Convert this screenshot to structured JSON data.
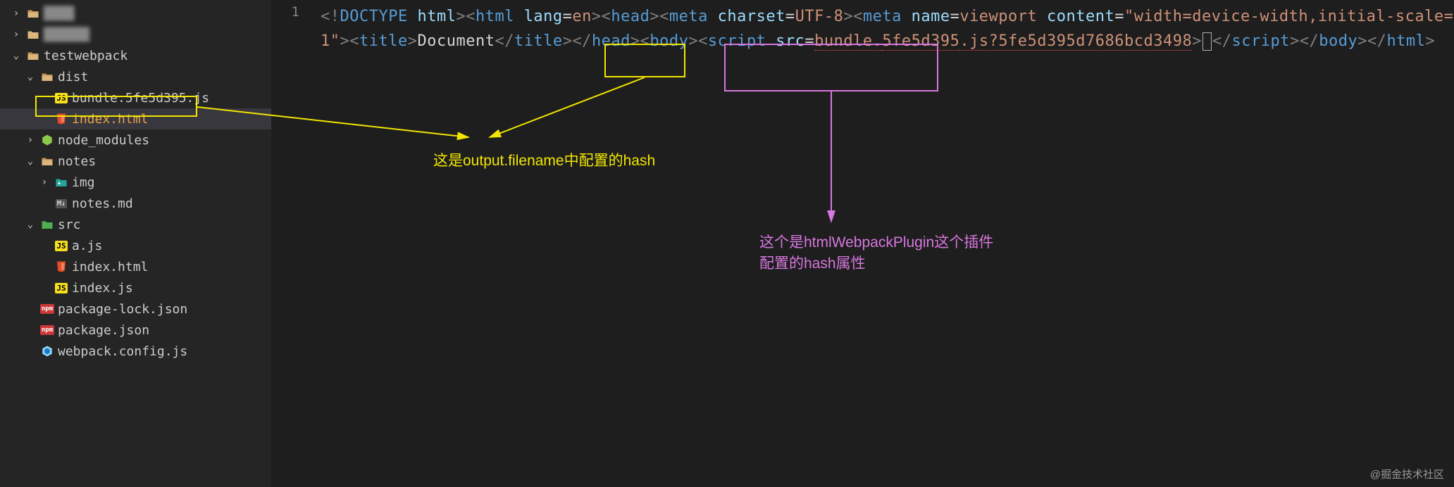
{
  "sidebar": {
    "items": [
      {
        "label": "████",
        "icon": "folder-open",
        "chevron": ">",
        "depth": 0,
        "blur": true
      },
      {
        "label": "██████",
        "icon": "folder",
        "chevron": ">",
        "depth": 0,
        "blur": true
      },
      {
        "label": "testwebpack",
        "icon": "folder-open",
        "chevron": "∨",
        "depth": 0
      },
      {
        "label": "dist",
        "icon": "folder-open",
        "chevron": "∨",
        "depth": 1
      },
      {
        "label": "bundle.5fe5d395.js",
        "icon": "js",
        "chevron": "",
        "depth": 2,
        "box": "yellow"
      },
      {
        "label": "index.html",
        "icon": "html",
        "chevron": "",
        "depth": 2,
        "selected": true
      },
      {
        "label": "node_modules",
        "icon": "node",
        "chevron": ">",
        "depth": 1
      },
      {
        "label": "notes",
        "icon": "folder-open",
        "chevron": "∨",
        "depth": 1
      },
      {
        "label": "img",
        "icon": "img-folder",
        "chevron": ">",
        "depth": 2
      },
      {
        "label": "notes.md",
        "icon": "md",
        "chevron": "",
        "depth": 2
      },
      {
        "label": "src",
        "icon": "src-folder",
        "chevron": "∨",
        "depth": 1
      },
      {
        "label": "a.js",
        "icon": "js",
        "chevron": "",
        "depth": 2
      },
      {
        "label": "index.html",
        "icon": "html",
        "chevron": "",
        "depth": 2
      },
      {
        "label": "index.js",
        "icon": "js",
        "chevron": "",
        "depth": 2
      },
      {
        "label": "package-lock.json",
        "icon": "npm",
        "chevron": "",
        "depth": 1
      },
      {
        "label": "package.json",
        "icon": "npm",
        "chevron": "",
        "depth": 1
      },
      {
        "label": "webpack.config.js",
        "icon": "webpack",
        "chevron": "",
        "depth": 1
      }
    ]
  },
  "editor": {
    "line_number": "1",
    "segments": {
      "doctype_open": "<!",
      "doctype": "DOCTYPE",
      "sp": " ",
      "html_attr": "html",
      "close": ">",
      "lt": "<",
      "html_tag": "html",
      "lang": "lang",
      "eq": "=",
      "en": "en",
      "head": "head",
      "meta": "meta",
      "charset": "charset",
      "utf8": "UTF-8",
      "name": "name",
      "viewport": "viewport",
      "content": "content",
      "content_val": "\"width=device-width,initial-scale=1\"",
      "title": "title",
      "title_text": "Document",
      "end": "</",
      "body": "body",
      "script": "script",
      "src": "src",
      "bundle_pre": "bundle.",
      "bundle_hash": "5fe5d395",
      "bundle_post": ".js?",
      "full_hash": "5fe5d395d7686bcd3498"
    }
  },
  "annotations": {
    "yellow_text": "这是output.filename中配置的hash",
    "magenta_text_l1": "这个是htmlWebpackPlugin这个插件",
    "magenta_text_l2": "配置的hash属性"
  },
  "watermark": "@掘金技术社区"
}
